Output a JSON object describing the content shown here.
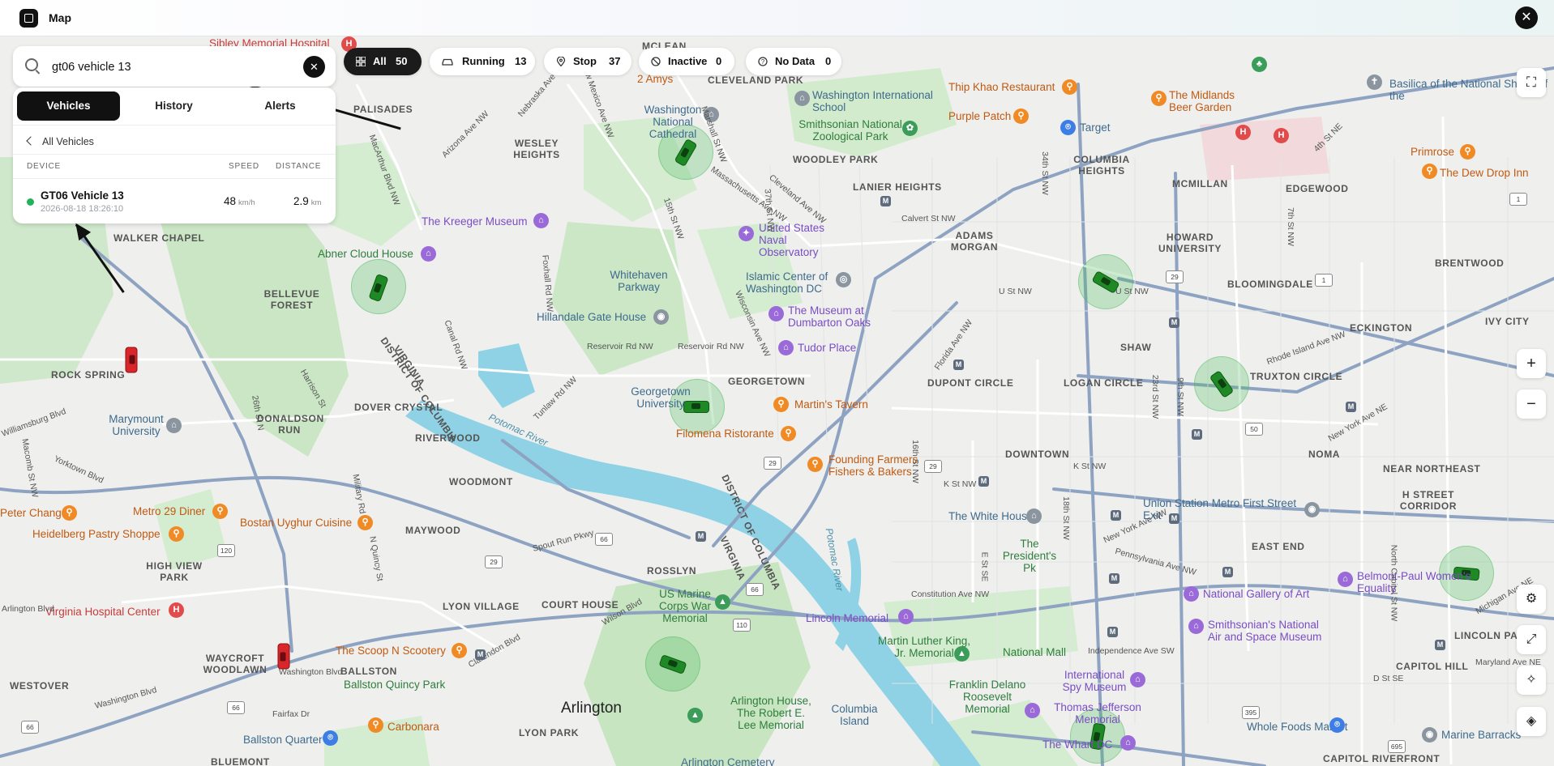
{
  "app": {
    "title": "Map",
    "close_symbol": "✕"
  },
  "search": {
    "value": "gt06 vehicle 13",
    "placeholder": "Search vehicles",
    "clear_symbol": "✕"
  },
  "tabs": [
    {
      "label": "Vehicles",
      "active": true
    },
    {
      "label": "History",
      "active": false
    },
    {
      "label": "Alerts",
      "active": false
    }
  ],
  "list": {
    "back_label": "All Vehicles",
    "columns": {
      "device": "DEVICE",
      "speed": "SPEED",
      "distance": "DISTANCE"
    },
    "rows": [
      {
        "name": "GT06 Vehicle 13",
        "timestamp": "2026-08-18 18:26:10",
        "speed": "48",
        "speed_unit": "km/h",
        "distance": "2.9",
        "distance_unit": "km",
        "status_color": "#22b35a"
      }
    ]
  },
  "filters": [
    {
      "label": "All",
      "count": "50",
      "icon": "grid-icon",
      "active": true
    },
    {
      "label": "Running",
      "count": "13",
      "icon": "car-icon",
      "active": false
    },
    {
      "label": "Stop",
      "count": "37",
      "icon": "location-pin-icon",
      "active": false
    },
    {
      "label": "Inactive",
      "count": "0",
      "icon": "inactive-slash-icon",
      "active": false
    },
    {
      "label": "No Data",
      "count": "0",
      "icon": "question-circle-icon",
      "active": false
    }
  ],
  "controls": {
    "fullscreen": "⛶",
    "zoom_in": "+",
    "zoom_out": "−",
    "adjust": "⚙",
    "expand": "⤢",
    "magic": "✧",
    "layers": "◈"
  },
  "map_labels": {
    "areas": [
      "MCLEAN",
      "CLEVELAND PARK",
      "WOODLEY PARK",
      "PALISADES",
      "WESLEY HEIGHTS",
      "LANIER HEIGHTS",
      "ADAMS MORGAN",
      "COLUMBIA HEIGHTS",
      "MCMILLAN",
      "EDGEWOOD",
      "HOWARD UNIVERSITY",
      "BRENTWOOD",
      "BLOOMINGDALE",
      "ECKINGTON",
      "IVY CITY",
      "WALKER CHAPEL",
      "BELLEVUE FOREST",
      "ROCK SPRING",
      "DOVER CRYSTAL",
      "DONALDSON RUN",
      "RIVERWOOD",
      "GEORGETOWN",
      "DUPONT CIRCLE",
      "LOGAN CIRCLE",
      "SHAW",
      "TRUXTON CIRCLE",
      "DOWNTOWN",
      "NOMA",
      "NEAR NORTHEAST",
      "H STREET CORRIDOR",
      "WOODMONT",
      "MAYWOOD",
      "HIGH VIEW PARK",
      "LYON VILLAGE",
      "COURT HOUSE",
      "ROSSLYN",
      "EAST END",
      "WAYCROFT WOODLAWN",
      "BALLSTON",
      "WESTOVER",
      "LYON PARK",
      "CAPITOL HILL",
      "LINCOLN PARK",
      "BLUEMONT",
      "CAPITOL RIVERFRONT"
    ],
    "pois": [
      "Sibley Memorial Hospital",
      "2 Amys",
      "Washington National Cathedral",
      "Washington International School",
      "Smithsonian National Zoological Park",
      "Thip Khao Restaurant",
      "Purple Patch",
      "Target",
      "The Midlands Beer Garden",
      "Basilica of the National Shrine of the",
      "Primrose",
      "The Dew Drop Inn",
      "The Kreeger Museum",
      "United States Naval Observatory",
      "Abner Cloud House",
      "Whitehaven Parkway",
      "Islamic Center of Washington DC",
      "Hillandale Gate House",
      "The Museum at Dumbarton Oaks",
      "Tudor Place",
      "Marymount University",
      "Georgetown University",
      "Martin's Tavern",
      "Filomena Ristorante",
      "Founding Farmers Fishers & Bakers",
      "Peter Chang",
      "Metro 29 Diner",
      "Bostan Uyghur Cuisine",
      "Heidelberg Pastry Shoppe",
      "The White House",
      "Union Station Metro First Street Exit",
      "The President's Pk",
      "Belmont-Paul Women's Equality",
      "Virginia Hospital Center",
      "US Marine Corps War Memorial",
      "National Gallery of Art",
      "Smithsonian's National Air and Space Museum",
      "Lincoln Memorial",
      "Martin Luther King, Jr. Memorial",
      "National Mall",
      "The Scoop N Scootery",
      "Ballston Quincy Park",
      "International Spy Museum",
      "Franklin Delano Roosevelt Memorial",
      "Arlington House, The Robert E. Lee Memorial",
      "Thomas Jefferson Memorial",
      "Columbia Island",
      "Whole Foods Market",
      "Marine Barracks",
      "Ballston Quarter",
      "Carbonara",
      "The Wharf DC",
      "Arlington Cemetery",
      "Arlington",
      "DISTRICT OF COLUMBIA",
      "VIRGINIA",
      "Potomac River"
    ],
    "roads": [
      "Nebraska Ave NW",
      "New Mexico Ave NW",
      "Arizona Ave NW",
      "MacArthur Blvd NW",
      "Foxhall Rd NW",
      "Reservoir Rd NW",
      "Canal Rd NW",
      "Massachusetts Ave NW",
      "Wisconsin Ave NW",
      "Cleveland Ave NW",
      "Calvert St NW",
      "U St NW",
      "Florida Ave NW",
      "Rhode Island Ave NW",
      "New York Ave NE",
      "K St NW",
      "New York Ave NW",
      "Pennsylvania Ave NW",
      "Constitution Ave NW",
      "Independence Ave SW",
      "D St SE",
      "Wilson Blvd",
      "Clarendon Blvd",
      "Washington Blvd",
      "Spout Run Pkwy",
      "N Quincy St",
      "Military Rd",
      "Yorktown Blvd",
      "26th St N",
      "Williamsburg Blvd",
      "Arlington Blvd",
      "Fairfax Dr",
      "George Washington Memorial Pkwy",
      "Marshall St NW",
      "37th St NW",
      "34th St NW",
      "16th St NW",
      "23rd St NW",
      "9th St NW",
      "7th St NW",
      "North Capitol St NW",
      "4th St NE",
      "Michigan Ave NE",
      "Maryland Ave NE",
      "E St SE",
      "18th St NW",
      "15th St NW",
      "Tunlaw Rd NW",
      "Macomb St NW",
      "Harrison St",
      "Ridge Rd"
    ],
    "highways": [
      "29",
      "1",
      "50",
      "66",
      "120",
      "110",
      "395",
      "695"
    ],
    "metro": "M"
  },
  "vehicles": [
    {
      "id": "veh-1",
      "status": "running",
      "color": "#1f8a25"
    },
    {
      "id": "veh-2",
      "status": "running",
      "color": "#1f8a25"
    },
    {
      "id": "veh-3",
      "status": "running",
      "color": "#1f8a25"
    },
    {
      "id": "veh-4",
      "status": "running",
      "color": "#1f8a25"
    },
    {
      "id": "veh-5",
      "status": "running",
      "color": "#1f8a25"
    },
    {
      "id": "veh-6",
      "status": "running",
      "color": "#1f8a25"
    },
    {
      "id": "veh-7",
      "status": "running",
      "color": "#1f8a25"
    },
    {
      "id": "veh-8",
      "status": "running",
      "color": "#1f8a25"
    },
    {
      "id": "veh-9",
      "status": "stopped",
      "color": "#d8262a"
    },
    {
      "id": "veh-10",
      "status": "stopped",
      "color": "#d8262a"
    }
  ],
  "colors": {
    "accent": "#111111",
    "running": "#22b35a",
    "water": "#8fd2e6",
    "park": "#c8e6c3",
    "road_major": "#8ea3c2"
  }
}
